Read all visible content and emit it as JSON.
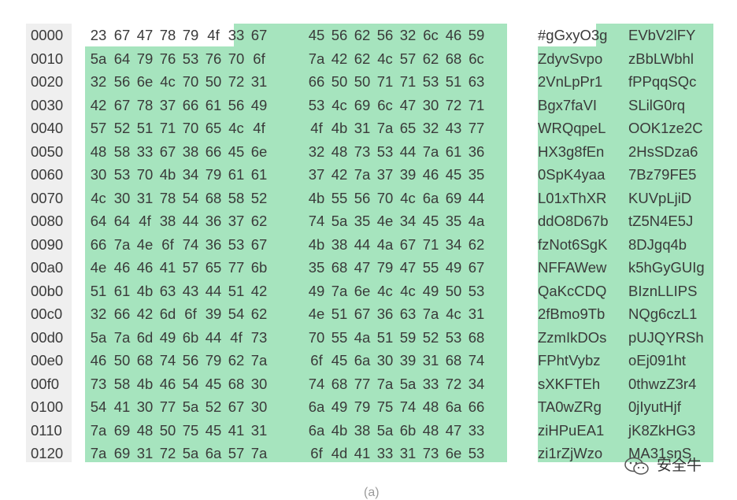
{
  "hexdump": {
    "rows": [
      {
        "offset": "0000",
        "bytes": [
          "23",
          "67",
          "47",
          "78",
          "79",
          "4f",
          "33",
          "67",
          "45",
          "56",
          "62",
          "56",
          "32",
          "6c",
          "46",
          "59"
        ],
        "ascii_left": "#gGxyO3g",
        "ascii_right": "EVbV2lFY"
      },
      {
        "offset": "0010",
        "bytes": [
          "5a",
          "64",
          "79",
          "76",
          "53",
          "76",
          "70",
          "6f",
          "7a",
          "42",
          "62",
          "4c",
          "57",
          "62",
          "68",
          "6c"
        ],
        "ascii_left": "ZdyvSvpo",
        "ascii_right": "zBbLWbhl"
      },
      {
        "offset": "0020",
        "bytes": [
          "32",
          "56",
          "6e",
          "4c",
          "70",
          "50",
          "72",
          "31",
          "66",
          "50",
          "50",
          "71",
          "71",
          "53",
          "51",
          "63"
        ],
        "ascii_left": "2VnLpPr1",
        "ascii_right": "fPPqqSQc"
      },
      {
        "offset": "0030",
        "bytes": [
          "42",
          "67",
          "78",
          "37",
          "66",
          "61",
          "56",
          "49",
          "53",
          "4c",
          "69",
          "6c",
          "47",
          "30",
          "72",
          "71"
        ],
        "ascii_left": "Bgx7faVI",
        "ascii_right": "SLilG0rq"
      },
      {
        "offset": "0040",
        "bytes": [
          "57",
          "52",
          "51",
          "71",
          "70",
          "65",
          "4c",
          "4f",
          "4f",
          "4b",
          "31",
          "7a",
          "65",
          "32",
          "43",
          "77"
        ],
        "ascii_left": "WRQqpeL",
        "ascii_right": "OOK1ze2C"
      },
      {
        "offset": "0050",
        "bytes": [
          "48",
          "58",
          "33",
          "67",
          "38",
          "66",
          "45",
          "6e",
          "32",
          "48",
          "73",
          "53",
          "44",
          "7a",
          "61",
          "36"
        ],
        "ascii_left": "HX3g8fEn",
        "ascii_right": "2HsSDza6"
      },
      {
        "offset": "0060",
        "bytes": [
          "30",
          "53",
          "70",
          "4b",
          "34",
          "79",
          "61",
          "61",
          "37",
          "42",
          "7a",
          "37",
          "39",
          "46",
          "45",
          "35"
        ],
        "ascii_left": "0SpK4yaa",
        "ascii_right": "7Bz79FE5"
      },
      {
        "offset": "0070",
        "bytes": [
          "4c",
          "30",
          "31",
          "78",
          "54",
          "68",
          "58",
          "52",
          "4b",
          "55",
          "56",
          "70",
          "4c",
          "6a",
          "69",
          "44"
        ],
        "ascii_left": "L01xThXR",
        "ascii_right": "KUVpLjiD"
      },
      {
        "offset": "0080",
        "bytes": [
          "64",
          "64",
          "4f",
          "38",
          "44",
          "36",
          "37",
          "62",
          "74",
          "5a",
          "35",
          "4e",
          "34",
          "45",
          "35",
          "4a"
        ],
        "ascii_left": "ddO8D67b",
        "ascii_right": "tZ5N4E5J"
      },
      {
        "offset": "0090",
        "bytes": [
          "66",
          "7a",
          "4e",
          "6f",
          "74",
          "36",
          "53",
          "67",
          "4b",
          "38",
          "44",
          "4a",
          "67",
          "71",
          "34",
          "62"
        ],
        "ascii_left": "fzNot6SgK",
        "ascii_right": "8DJgq4b"
      },
      {
        "offset": "00a0",
        "bytes": [
          "4e",
          "46",
          "46",
          "41",
          "57",
          "65",
          "77",
          "6b",
          "35",
          "68",
          "47",
          "79",
          "47",
          "55",
          "49",
          "67"
        ],
        "ascii_left": "NFFAWew",
        "ascii_right": "k5hGyGUIg"
      },
      {
        "offset": "00b0",
        "bytes": [
          "51",
          "61",
          "4b",
          "63",
          "43",
          "44",
          "51",
          "42",
          "49",
          "7a",
          "6e",
          "4c",
          "4c",
          "49",
          "50",
          "53"
        ],
        "ascii_left": "QaKcCDQ",
        "ascii_right": "BIznLLIPS"
      },
      {
        "offset": "00c0",
        "bytes": [
          "32",
          "66",
          "42",
          "6d",
          "6f",
          "39",
          "54",
          "62",
          "4e",
          "51",
          "67",
          "36",
          "63",
          "7a",
          "4c",
          "31"
        ],
        "ascii_left": "2fBmo9Tb",
        "ascii_right": "NQg6czL1"
      },
      {
        "offset": "00d0",
        "bytes": [
          "5a",
          "7a",
          "6d",
          "49",
          "6b",
          "44",
          "4f",
          "73",
          "70",
          "55",
          "4a",
          "51",
          "59",
          "52",
          "53",
          "68"
        ],
        "ascii_left": "ZzmIkDOs",
        "ascii_right": "pUJQYRSh"
      },
      {
        "offset": "00e0",
        "bytes": [
          "46",
          "50",
          "68",
          "74",
          "56",
          "79",
          "62",
          "7a",
          "6f",
          "45",
          "6a",
          "30",
          "39",
          "31",
          "68",
          "74"
        ],
        "ascii_left": "FPhtVybz",
        "ascii_right": "oEj091ht"
      },
      {
        "offset": "00f0",
        "bytes": [
          "73",
          "58",
          "4b",
          "46",
          "54",
          "45",
          "68",
          "30",
          "74",
          "68",
          "77",
          "7a",
          "5a",
          "33",
          "72",
          "34"
        ],
        "ascii_left": "sXKFTEh",
        "ascii_right": "0thwzZ3r4"
      },
      {
        "offset": "0100",
        "bytes": [
          "54",
          "41",
          "30",
          "77",
          "5a",
          "52",
          "67",
          "30",
          "6a",
          "49",
          "79",
          "75",
          "74",
          "48",
          "6a",
          "66"
        ],
        "ascii_left": "TA0wZRg",
        "ascii_right": "0jIyutHjf"
      },
      {
        "offset": "0110",
        "bytes": [
          "7a",
          "69",
          "48",
          "50",
          "75",
          "45",
          "41",
          "31",
          "6a",
          "4b",
          "38",
          "5a",
          "6b",
          "48",
          "47",
          "33"
        ],
        "ascii_left": "ziHPuEA1",
        "ascii_right": "jK8ZkHG3"
      },
      {
        "offset": "0120",
        "bytes": [
          "7a",
          "69",
          "31",
          "72",
          "5a",
          "6a",
          "57",
          "7a",
          "6f",
          "4d",
          "41",
          "33",
          "31",
          "73",
          "6e",
          "53"
        ],
        "ascii_left": "zi1rZjWzo",
        "ascii_right": "MA31snS"
      }
    ]
  },
  "caption": "(a)",
  "watermark": {
    "text": "安全牛",
    "icon": "wechat-icon"
  },
  "colors": {
    "highlight": "#a6e4be",
    "offset_gutter": "#efefef",
    "text": "#3a3a3a"
  }
}
